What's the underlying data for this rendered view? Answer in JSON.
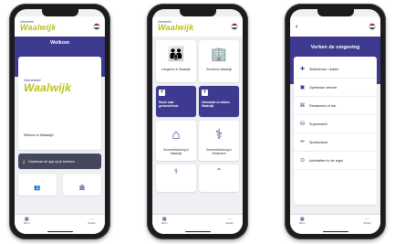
{
  "phone1": {
    "brand_small": "Gemeente",
    "brand_big": "Waalwijk",
    "title": "Welkom",
    "card_brand_small": "Gemeente",
    "card_brand_big": "Waalwijk",
    "welcome_text": "Welkom in Waalwijk!",
    "download_label": "Download de app op je telefoon",
    "download_icon": "download-icon",
    "bottom": {
      "left_label": "Menu",
      "right_label": "Zoeken"
    }
  },
  "phone2": {
    "brand_small": "Gemeente",
    "brand_big": "Waalwijk",
    "tiles": [
      {
        "icon": "people-icon",
        "label": "Integreren in Waalwijk",
        "dark": false
      },
      {
        "icon": "townhall-icon",
        "label": "Gemeente Waalwijk",
        "dark": false
      },
      {
        "icon": "plus-icon",
        "label": "Route naar gemeentehuis",
        "dark": true
      },
      {
        "icon": "plus-icon",
        "label": "Informatie en advies Waalwijk",
        "dark": true
      },
      {
        "icon": "medical-house-icon",
        "label": "Gezondheidszorg in Waalwijk",
        "dark": false
      },
      {
        "icon": "stethoscope-icon",
        "label": "Gezondheidszorg in Nederland",
        "dark": false
      }
    ],
    "bottom": {
      "left_label": "Menu",
      "right_label": "Zoeken"
    }
  },
  "phone3": {
    "title": "Verken de omgeving",
    "items": [
      {
        "icon": "hospital-icon",
        "label": "Ziekenhuis / dokter"
      },
      {
        "icon": "bus-icon",
        "label": "Openbaar vervoer"
      },
      {
        "icon": "restaurant-icon",
        "label": "Restaurant of bar"
      },
      {
        "icon": "cart-icon",
        "label": "Supermarkt"
      },
      {
        "icon": "dumbbell-icon",
        "label": "Sportschool"
      },
      {
        "icon": "location-icon",
        "label": "Activiteiten in de regio"
      }
    ],
    "bottom": {
      "left_label": "Menu",
      "right_label": "Zoeken"
    }
  },
  "colors": {
    "primary": "#3d3a8f",
    "brand_green": "#b9c21a",
    "download_bg": "#45475c"
  }
}
